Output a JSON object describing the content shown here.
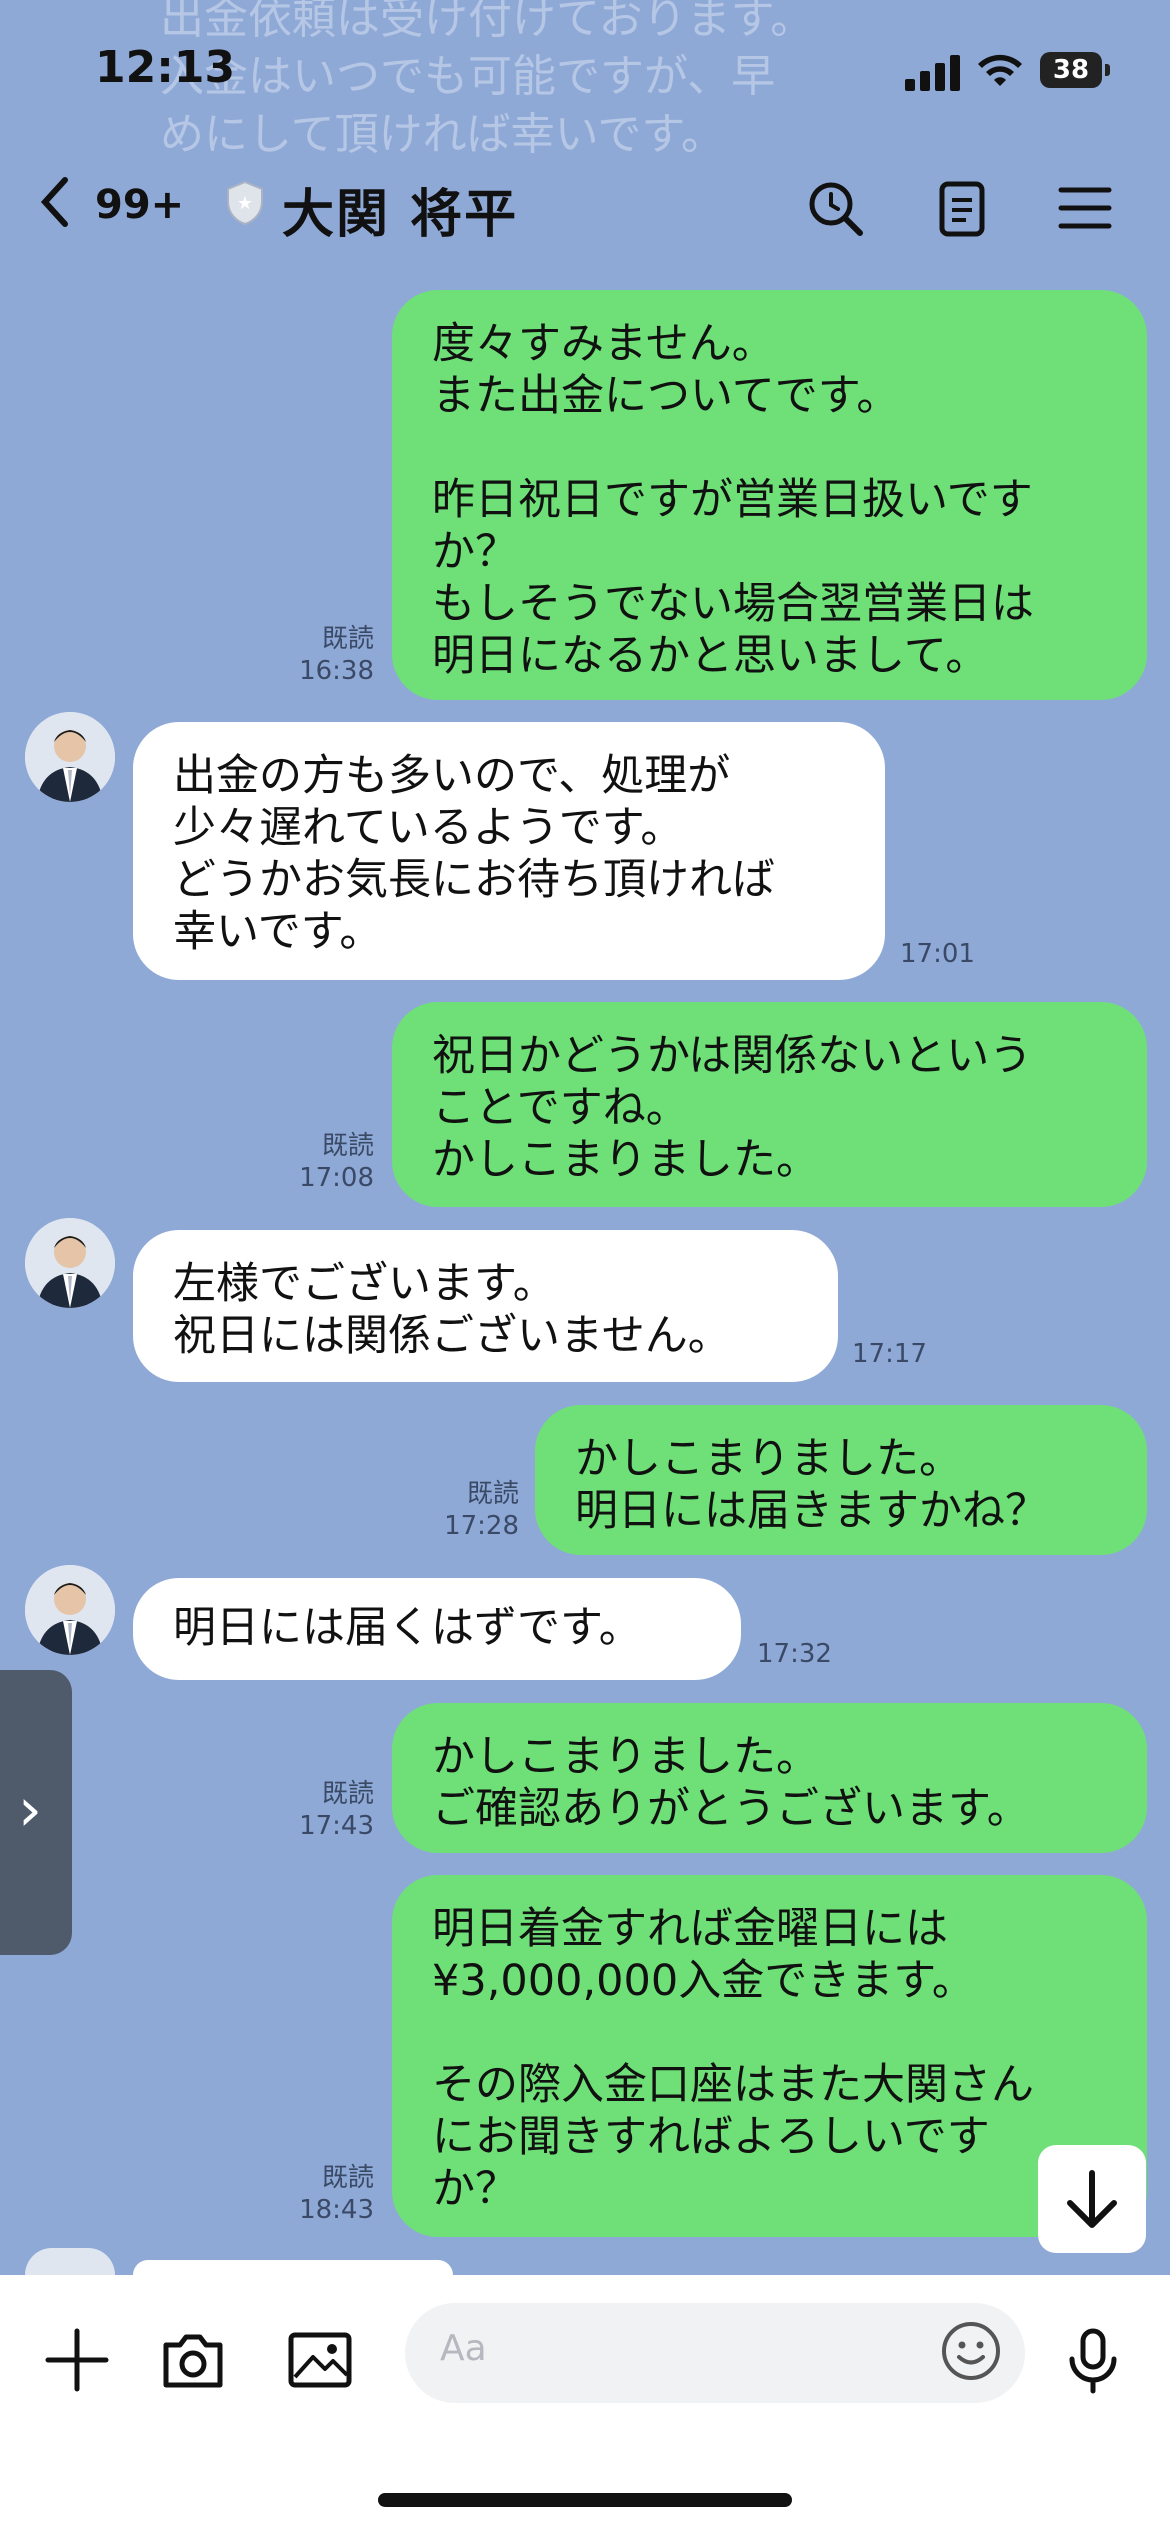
{
  "ghost_text": "出金依頼は受け付けております。\n入金はいつでも可能ですが、早\nめにして頂ければ幸いです。",
  "status": {
    "time": "12:13",
    "battery": "38"
  },
  "header": {
    "back_count": "99+",
    "contact_name": "大関 将平"
  },
  "messages": [
    {
      "text": "度々すみません。\nまた出金についてです。\n\n昨日祝日ですが営業日扱いです\nか？\nもしそうでない場合翌営業日は\n明日になるかと思いまして。",
      "read": "既読",
      "time": "16:38"
    },
    {
      "text": "出金の方も多いので、処理が\n少々遅れているようです。\nどうかお気長にお待ち頂ければ\n幸いです。",
      "time": "17:01"
    },
    {
      "text": "祝日かどうかは関係ないという\nことですね。\nかしこまりました。",
      "read": "既読",
      "time": "17:08"
    },
    {
      "text": "左様でございます。\n祝日には関係ございません。",
      "time": "17:17"
    },
    {
      "text": "かしこまりました。\n明日には届きますかね？",
      "read": "既読",
      "time": "17:28"
    },
    {
      "text": "明日には届くはずです。",
      "time": "17:32"
    },
    {
      "text": "かしこまりました。\nご確認ありがとうございます。",
      "read": "既読",
      "time": "17:43"
    },
    {
      "text": "明日着金すれば金曜日には\n¥3,000,000入金できます。\n\nその際入金口座はまた大関さん\nにお聞きすればよろしいです\nか？",
      "read": "既読",
      "time": "18:43"
    }
  ],
  "input": {
    "placeholder": "Aa"
  },
  "colors": {
    "background": "#8fa9d7",
    "outgoing_bubble": "#6ee077",
    "incoming_bubble": "#ffffff"
  }
}
